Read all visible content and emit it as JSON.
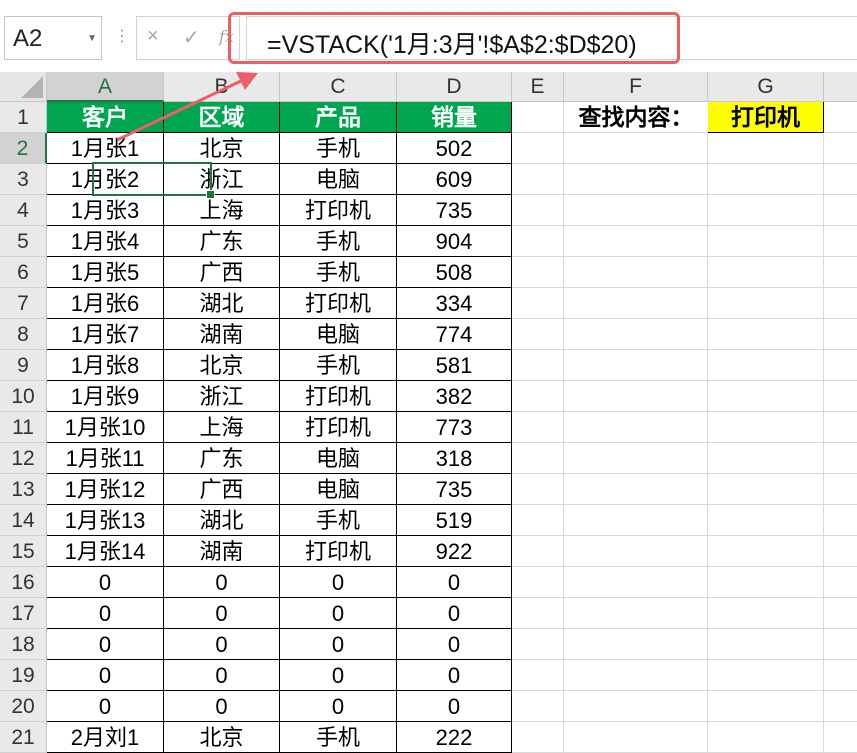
{
  "name_box": {
    "value": "A2"
  },
  "formula_bar": {
    "cancel_icon": "×",
    "enter_icon": "✓",
    "fx_icon": "fx",
    "formula": "=VSTACK('1月:3月'!$A$2:$D$20)"
  },
  "columns": [
    "A",
    "B",
    "C",
    "D",
    "E",
    "F",
    "G"
  ],
  "rows": [
    "1",
    "2",
    "3",
    "4",
    "5",
    "6",
    "7",
    "8",
    "9",
    "10",
    "11",
    "12",
    "13",
    "14",
    "15",
    "16",
    "17",
    "18",
    "19",
    "20",
    "21"
  ],
  "table": {
    "headers": [
      "客户",
      "区域",
      "产品",
      "销量"
    ],
    "rows": [
      [
        "1月张1",
        "北京",
        "手机",
        "502"
      ],
      [
        "1月张2",
        "浙江",
        "电脑",
        "609"
      ],
      [
        "1月张3",
        "上海",
        "打印机",
        "735"
      ],
      [
        "1月张4",
        "广东",
        "手机",
        "904"
      ],
      [
        "1月张5",
        "广西",
        "手机",
        "508"
      ],
      [
        "1月张6",
        "湖北",
        "打印机",
        "334"
      ],
      [
        "1月张7",
        "湖南",
        "电脑",
        "774"
      ],
      [
        "1月张8",
        "北京",
        "手机",
        "581"
      ],
      [
        "1月张9",
        "浙江",
        "打印机",
        "382"
      ],
      [
        "1月张10",
        "上海",
        "打印机",
        "773"
      ],
      [
        "1月张11",
        "广东",
        "电脑",
        "318"
      ],
      [
        "1月张12",
        "广西",
        "电脑",
        "735"
      ],
      [
        "1月张13",
        "湖北",
        "手机",
        "519"
      ],
      [
        "1月张14",
        "湖南",
        "打印机",
        "922"
      ],
      [
        "0",
        "0",
        "0",
        "0"
      ],
      [
        "0",
        "0",
        "0",
        "0"
      ],
      [
        "0",
        "0",
        "0",
        "0"
      ],
      [
        "0",
        "0",
        "0",
        "0"
      ],
      [
        "0",
        "0",
        "0",
        "0"
      ],
      [
        "2月刘1",
        "北京",
        "手机",
        "222"
      ]
    ]
  },
  "lookup": {
    "label": "查找内容：",
    "value": "打印机"
  },
  "colors": {
    "header_green": "#00a550",
    "highlight_red": "#ec5f67",
    "lookup_yellow": "#ffff00",
    "excel_green": "#217346"
  }
}
